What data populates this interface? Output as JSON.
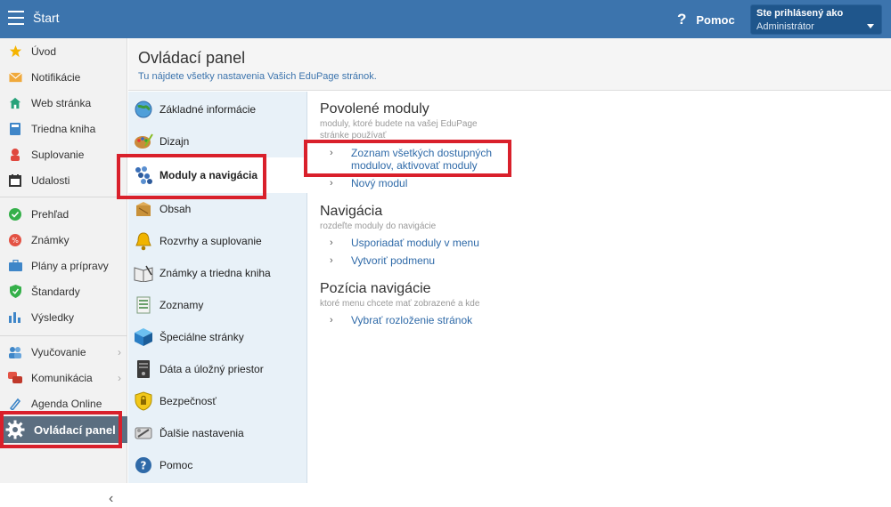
{
  "topbar": {
    "title": "Štart",
    "help_label": "Pomoc",
    "user_line1": "Ste prihlásený ako",
    "user_line2": "Administrátor"
  },
  "sidebar": {
    "items": [
      {
        "label": "Úvod",
        "icon": "star-icon"
      },
      {
        "label": "Notifikácie",
        "icon": "envelope-icon"
      },
      {
        "label": "Web stránka",
        "icon": "house-icon"
      },
      {
        "label": "Triedna kniha",
        "icon": "book-icon"
      },
      {
        "label": "Suplovanie",
        "icon": "person-icon"
      },
      {
        "label": "Udalosti",
        "icon": "calendar-icon"
      },
      {
        "label": "Prehľad",
        "icon": "check-circle-icon"
      },
      {
        "label": "Známky",
        "icon": "grade-icon"
      },
      {
        "label": "Plány a prípravy",
        "icon": "briefcase-icon"
      },
      {
        "label": "Štandardy",
        "icon": "shield-icon"
      },
      {
        "label": "Výsledky",
        "icon": "bar-chart-icon"
      },
      {
        "label": "Vyučovanie",
        "icon": "people-icon"
      },
      {
        "label": "Komunikácia",
        "icon": "chat-icon"
      },
      {
        "label": "Agenda Online",
        "icon": "pen-icon"
      },
      {
        "label": "Ovládací panel",
        "icon": "gear-icon"
      }
    ]
  },
  "header": {
    "title": "Ovládací panel",
    "subtitle": "Tu nájdete všetky nastavenia Vašich EduPage stránok."
  },
  "menu": {
    "items": [
      {
        "label": "Základné informácie",
        "icon": "globe-icon"
      },
      {
        "label": "Dizajn",
        "icon": "palette-icon"
      },
      {
        "label": "Moduly a navigácia",
        "icon": "modules-icon"
      },
      {
        "label": "Obsah",
        "icon": "box-icon"
      },
      {
        "label": "Rozvrhy a suplovanie",
        "icon": "bell-icon"
      },
      {
        "label": "Známky a triedna kniha",
        "icon": "notebook-icon"
      },
      {
        "label": "Zoznamy",
        "icon": "list-icon"
      },
      {
        "label": "Špeciálne stránky",
        "icon": "cube-icon"
      },
      {
        "label": "Dáta a úložný priestor",
        "icon": "server-icon"
      },
      {
        "label": "Bezpečnosť",
        "icon": "lock-shield-icon"
      },
      {
        "label": "Ďalšie nastavenia",
        "icon": "tools-icon"
      },
      {
        "label": "Pomoc",
        "icon": "help-icon"
      }
    ]
  },
  "content": {
    "sections": [
      {
        "title": "Povolené moduly",
        "subtitle_line1": "moduly, ktoré budete na vašej EduPage",
        "subtitle_line2": "stránke používať",
        "links": [
          {
            "line1": "Zoznam všetkých dostupných",
            "line2": "modulov, aktivovať moduly"
          },
          {
            "line1": "Nový modul"
          }
        ]
      },
      {
        "title": "Navigácia",
        "subtitle_line1": "rozdeľte moduly do navigácie",
        "links": [
          {
            "line1": "Usporiadať moduly v menu"
          },
          {
            "line1": "Vytvoriť podmenu"
          }
        ]
      },
      {
        "title": "Pozícia navigácie",
        "subtitle_line1": "ktoré menu chcete mať zobrazené a kde",
        "links": [
          {
            "line1": "Vybrať rozloženie stránok"
          }
        ]
      }
    ]
  },
  "colors": {
    "topbar": "#3c74ad",
    "highlight": "#d9202b",
    "link": "#2f6aa8",
    "active_sidebar": "#5b6e80"
  }
}
